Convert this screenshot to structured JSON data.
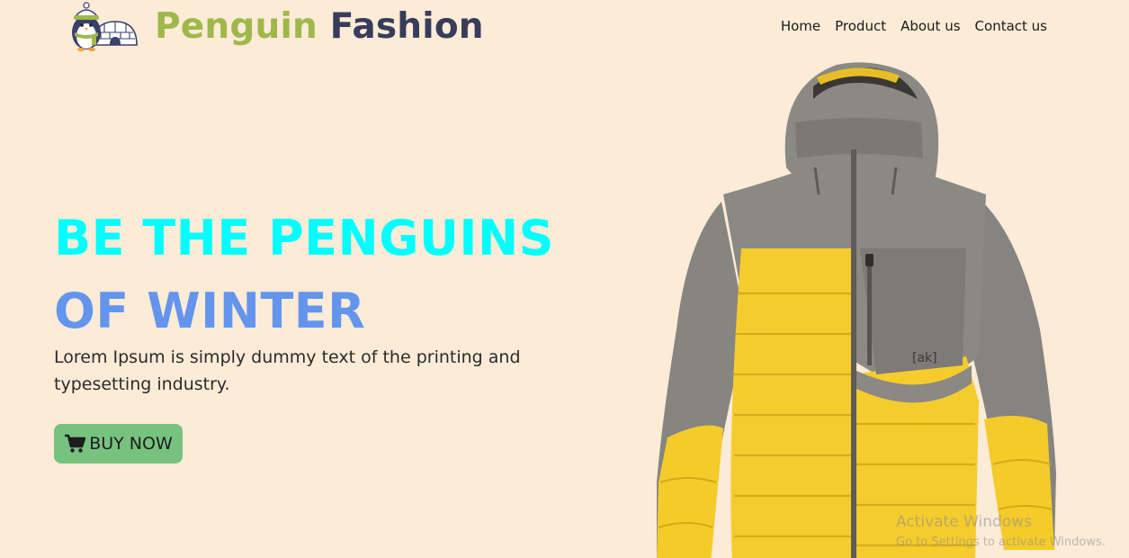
{
  "header": {
    "brand_word1": "Penguin",
    "brand_word2": "Fashion",
    "logo_icon": "penguin-igloo-logo",
    "nav": [
      {
        "label": "Home"
      },
      {
        "label": "Product"
      },
      {
        "label": "About us"
      },
      {
        "label": "Contact us"
      }
    ]
  },
  "hero": {
    "title_line1": "BE THE PENGUINS",
    "title_line2": "OF WINTER",
    "description": "Lorem Ipsum is simply dummy text of the printing and typesetting industry.",
    "buy_label": "BUY NOW",
    "buy_icon": "shopping-cart-icon",
    "product_image": "yellow-grey-puffer-jacket",
    "jacket_brand_mark": "[ak]"
  },
  "watermark": {
    "title": "Activate Windows",
    "subtitle": "Go to Settings to activate Windows."
  },
  "colors": {
    "background": "#fbebd7",
    "brand_green": "#9fb84a",
    "brand_navy": "#383c5b",
    "title_cyan": "#00ffff",
    "title_blue": "#6495ed",
    "button_green": "#77c27f"
  }
}
